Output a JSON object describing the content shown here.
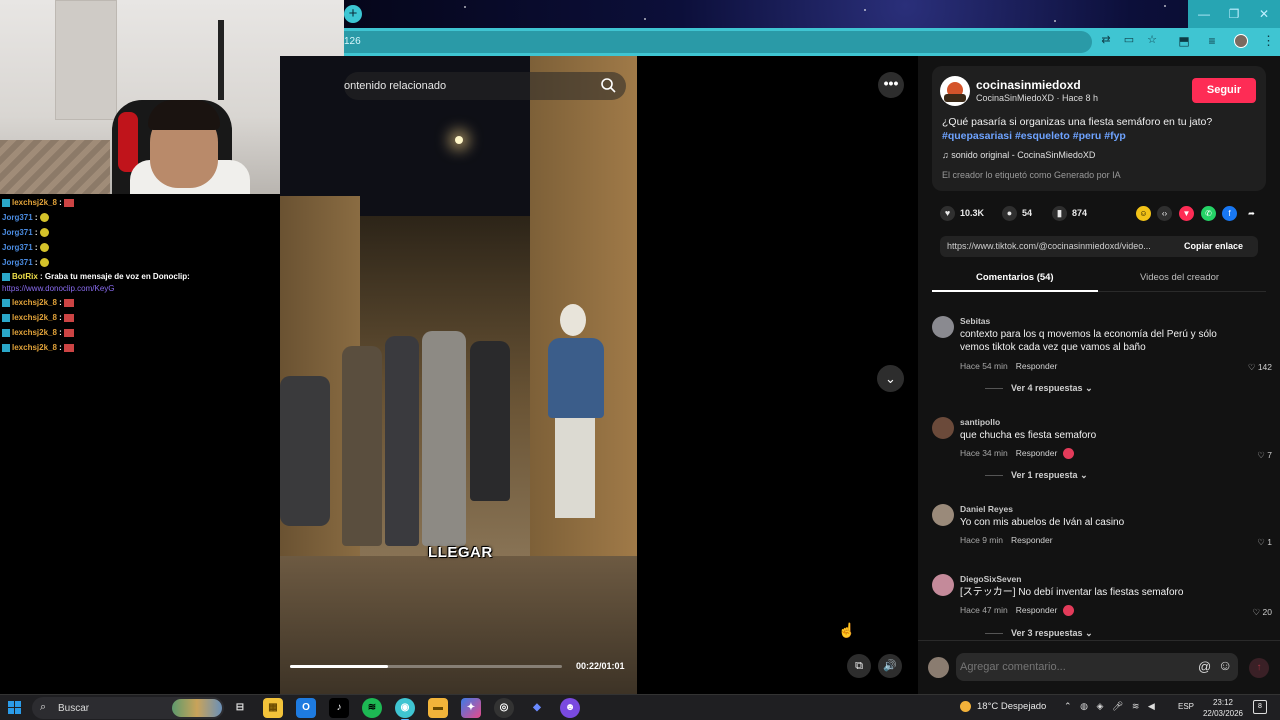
{
  "browser": {
    "address_text": "126",
    "newtab_symbol": "+",
    "window_controls": {
      "minimize": "—",
      "maximize": "❐",
      "close": "✕"
    }
  },
  "chat": {
    "lines": [
      {
        "user": "lexchsj2k_8",
        "sep": " :",
        "style": "a"
      },
      {
        "user": "Jorg371",
        "sep": " :",
        "style": "b"
      },
      {
        "user": "Jorg371",
        "sep": " :",
        "style": "b"
      },
      {
        "user": "Jorg371",
        "sep": " :",
        "style": "b"
      },
      {
        "user": "Jorg371",
        "sep": " :",
        "style": "b"
      },
      {
        "user": "BotRix",
        "sep": " : ",
        "message": "Graba tu mensaje de voz en Donoclip:",
        "style": "c"
      },
      {
        "user": "lexchsj2k_8",
        "sep": " :",
        "style": "a"
      },
      {
        "user": "lexchsj2k_8",
        "sep": " :",
        "style": "a"
      },
      {
        "user": "lexchsj2k_8",
        "sep": " :",
        "style": "a"
      },
      {
        "user": "lexchsj2k_8",
        "sep": " :",
        "style": "a"
      }
    ],
    "link": "https://www.donoclip.com/KeyG"
  },
  "video": {
    "search_placeholder": "ontenido relacionado",
    "caption": "LLEGAR",
    "time": "00:22/01:01",
    "progress": 0.36
  },
  "post": {
    "creator": "cocinasinmiedoxd",
    "creator_sub": "CocinaSinMiedoXD · Hace 8 h",
    "follow_label": "Seguir",
    "description": "¿Qué pasaría si organizas una fiesta semáforo en tu jato?",
    "hashtags": "#quepasariasi #esqueleto #peru #fyp",
    "sound": "sonido original - CocinaSinMiedoXD",
    "ai_label": "El creador lo etiquetó como Generado por IA",
    "likes": "10.3K",
    "comments": "54",
    "saves": "874",
    "link": "https://www.tiktok.com/@cocinasinmiedoxd/video...",
    "copy_label": "Copiar enlace"
  },
  "tabs": {
    "comments": "Comentarios (54)",
    "creator_videos": "Videos del creador"
  },
  "comments": [
    {
      "user": "Sebitas",
      "text": "contexto para los q movemos la economía del Perú y sólo vemos tiktok cada vez que vamos al baño",
      "time": "Hace 54 min",
      "reply": "Responder",
      "likes": "142",
      "more": "Ver 4 respuestas"
    },
    {
      "user": "santipollo",
      "text": "que chucha es fiesta semaforo",
      "time": "Hace 34 min",
      "reply": "Responder",
      "likes": "7",
      "more": "Ver 1 respuesta"
    },
    {
      "user": "Daniel Reyes",
      "text": "Yo con mis abuelos de Iván al casino",
      "time": "Hace 9 min",
      "reply": "Responder",
      "likes": "1",
      "more": ""
    },
    {
      "user": "DiegoSixSeven",
      "text": "[ステッカー] No debí inventar las fiestas semaforo",
      "time": "Hace 47 min",
      "reply": "Responder",
      "likes": "20",
      "more": "Ver 3 respuestas"
    }
  ],
  "comment_input": {
    "placeholder": "Agregar comentario..."
  },
  "taskbar": {
    "search_label": "Buscar",
    "weather": "18°C  Despejado",
    "lang": "ESP",
    "time": "23:12",
    "date": "22/03/2026",
    "notif": "8"
  },
  "colors": {
    "follow": "#fe2c55",
    "hashtag": "#6ea3ff",
    "chrome_accent": "#3fc5d2"
  },
  "icons": [
    "search-icon",
    "more-icon",
    "chevron-down-icon",
    "heart-icon",
    "comment-icon",
    "bookmark-icon",
    "share-icon",
    "music-icon",
    "volume-icon",
    "minimize-icon",
    "emoji-icon",
    "mention-icon",
    "windows-start-icon"
  ]
}
